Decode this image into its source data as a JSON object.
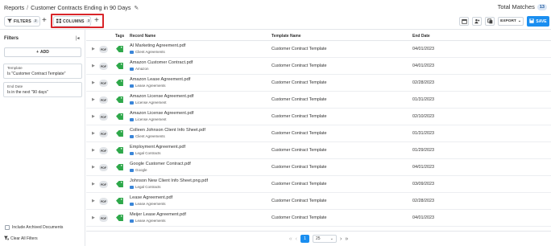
{
  "breadcrumb": {
    "root": "Reports",
    "separator": "/",
    "title": "Customer Contracts Ending in 90 Days"
  },
  "total_matches": {
    "label": "Total Matches",
    "count": "13"
  },
  "toolbar": {
    "filters_label": "FILTERS",
    "filters_count": "2",
    "columns_label": "COLUMNS",
    "columns_count": "3",
    "export_label": "EXPORT",
    "save_label": "SAVE"
  },
  "sidebar": {
    "title": "Filters",
    "add_label": "ADD",
    "filters": [
      {
        "label": "Template",
        "value": "Is \"Customer Contract Template\""
      },
      {
        "label": "End Date",
        "value": "Is in the next \"90 days\""
      }
    ],
    "archived_label": "Include Archived Documents",
    "clear_label": "Clear All Filters"
  },
  "table": {
    "headers": {
      "tags": "Tags",
      "record": "Record Name",
      "template": "Template Name",
      "end_date": "End Date"
    },
    "file_badge": "PDF",
    "rows": [
      {
        "name": "AI Marketing Agreement.pdf",
        "folder": "Client Agreements",
        "template": "Customer Contract Template",
        "date": "04/01/2023"
      },
      {
        "name": "Amazon Customer Contract.pdf",
        "folder": "Amazon",
        "template": "Customer Contract Template",
        "date": "04/01/2023"
      },
      {
        "name": "Amazon Lease Agreement.pdf",
        "folder": "Lease Agreements",
        "template": "Customer Contract Template",
        "date": "02/28/2023"
      },
      {
        "name": "Amazon License Agreement.pdf",
        "folder": "License Agreement",
        "template": "Customer Contract Template",
        "date": "01/31/2023"
      },
      {
        "name": "Amazon License Agreement.pdf",
        "folder": "License Agreement",
        "template": "Customer Contract Template",
        "date": "02/10/2023"
      },
      {
        "name": "Colleen Johnson Client Info Sheet.pdf",
        "folder": "Client Agreements",
        "template": "Customer Contract Template",
        "date": "01/31/2023"
      },
      {
        "name": "Employment Agreement.pdf",
        "folder": "Legal Contracts",
        "template": "Customer Contract Template",
        "date": "01/29/2023"
      },
      {
        "name": "Google Customer Contract.pdf",
        "folder": "Google",
        "template": "Customer Contract Template",
        "date": "04/01/2023"
      },
      {
        "name": "Johnson New Client Info Sheet.png.pdf",
        "folder": "Legal Contracts",
        "template": "Customer Contract Template",
        "date": "03/09/2023"
      },
      {
        "name": "Lease Agreement.pdf",
        "folder": "Lease Agreements",
        "template": "Customer Contract Template",
        "date": "02/28/2023"
      },
      {
        "name": "Meijer Lease Agreement.pdf",
        "folder": "Lease Agreements",
        "template": "Customer Contract Template",
        "date": "04/01/2023"
      }
    ]
  },
  "pagination": {
    "current_page": "1",
    "per_page": "25"
  },
  "colors": {
    "accent": "#1a8ef0",
    "highlight": "#d9252a",
    "tag_green": "#2ea84a",
    "folder_blue": "#3b86d8"
  },
  "icons": [
    "edit-icon",
    "filter-icon",
    "columns-icon",
    "plus-icon",
    "calendar-icon",
    "people-icon",
    "copy-icon",
    "save-icon",
    "collapse-icon",
    "expand-icon",
    "tag-icon",
    "folder-icon",
    "clear-filter-icon",
    "first-page-icon",
    "prev-page-icon",
    "next-page-icon",
    "last-page-icon"
  ]
}
